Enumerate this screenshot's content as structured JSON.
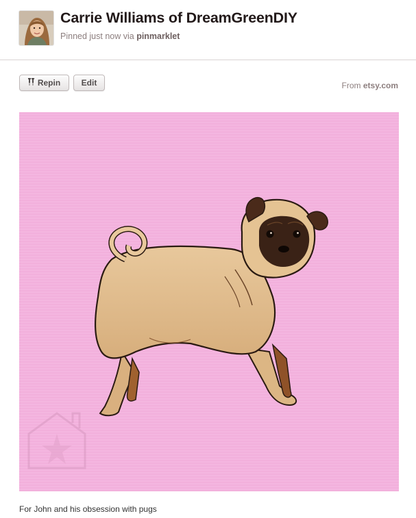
{
  "pin": {
    "pinner_name": "Carrie Williams of DreamGreenDIY",
    "pinned_prefix": "Pinned just now via",
    "pinned_via": "pinmarklet",
    "source_prefix": "From",
    "source_domain": "etsy.com",
    "description": "For John and his obsession with pugs"
  },
  "actions": {
    "repin_label": "Repin",
    "edit_label": "Edit"
  },
  "icons": {
    "repin": "pushpin-icon",
    "watermark": "house-star-watermark"
  },
  "colors": {
    "image_background": "#f4b3de",
    "title_text": "#221919",
    "meta_text": "#8c7e7e"
  }
}
